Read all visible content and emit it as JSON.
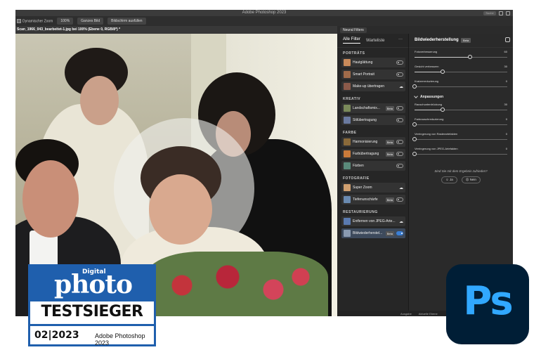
{
  "window": {
    "title": "Adobe Photoshop 2023",
    "search_placeholder": "Suche"
  },
  "options_bar": {
    "scroll_all_label": "Dynamischer Zoom",
    "zoom": "100%",
    "fit_label": "Ganzes Bild",
    "fill_label": "Bildschirm ausfüllen"
  },
  "document": {
    "tab_title": "Scan_1966_043_bearbeitet-1.jpg bei 100% (Ebene 0, RGB/8*) *"
  },
  "neural_filters": {
    "panel_title": "Neural Filters",
    "tabs": {
      "all": "Alle Filter",
      "waitlist": "Warteliste",
      "more": "···"
    },
    "sections": [
      {
        "title": "PORTRÄTS",
        "items": [
          {
            "label": "Hautglättung",
            "control": "toggle"
          },
          {
            "label": "Smart Portrait",
            "control": "toggle"
          },
          {
            "label": "Make-up übertragen",
            "control": "cloud"
          }
        ]
      },
      {
        "title": "KREATIV",
        "items": [
          {
            "label": "Landschaftsmix...",
            "beta": "Beta",
            "control": "toggle"
          },
          {
            "label": "Stilübertragung",
            "control": "toggle"
          }
        ]
      },
      {
        "title": "FARBE",
        "items": [
          {
            "label": "Harmonisierung",
            "beta": "Beta",
            "control": "toggle"
          },
          {
            "label": "Farbübertragung",
            "beta": "Beta",
            "control": "toggle"
          },
          {
            "label": "Färben",
            "control": "toggle"
          }
        ]
      },
      {
        "title": "FOTOGRAFIE",
        "items": [
          {
            "label": "Super Zoom",
            "control": "cloud"
          },
          {
            "label": "Tiefenunschärfe",
            "beta": "Beta",
            "control": "toggle"
          }
        ]
      },
      {
        "title": "RESTAURIERUNG",
        "items": [
          {
            "label": "Entfernen von JPEG-Arte...",
            "control": "cloud"
          },
          {
            "label": "Bildwiederherstel...",
            "beta": "Beta",
            "control": "toggle-on",
            "active": true
          }
        ]
      }
    ],
    "detail": {
      "title": "Bildwiederherstellung",
      "beta": "Beta",
      "sliders": [
        {
          "label": "Fotoverbesserung",
          "value": 60
        },
        {
          "label": "Gesicht verbessern",
          "value": 30
        },
        {
          "label": "Kratzerreduzierung",
          "value": 0
        }
      ],
      "adjustments_title": "Anpassungen",
      "adjust_sliders": [
        {
          "label": "Rauschunterdrückung",
          "value": 30
        },
        {
          "label": "Farbrauschreduzierung",
          "value": 0
        },
        {
          "label": "Verringerung von Rasterartefakten",
          "value": 0
        },
        {
          "label": "Verringerung von JPEG-Artefakten",
          "value": 0
        }
      ],
      "feedback_question": "Sind Sie mit dem Ergebnis zufrieden?",
      "yes": "Ja",
      "no": "Nein"
    },
    "bottom": {
      "output_label": "Ausgabe",
      "output_value": "Aktuelle Ebene"
    }
  },
  "badge": {
    "digital": "Digital",
    "photo": "photo",
    "award": "TESTSIEGER",
    "issue": "02|2023",
    "product": "Adobe Photoshop 2023"
  },
  "ps_logo": {
    "text": "Ps"
  },
  "colors": {
    "accent": "#3a7fd6",
    "badge_blue": "#1f5fad",
    "ps_bg": "#001e36",
    "ps_fg": "#31a8ff"
  }
}
